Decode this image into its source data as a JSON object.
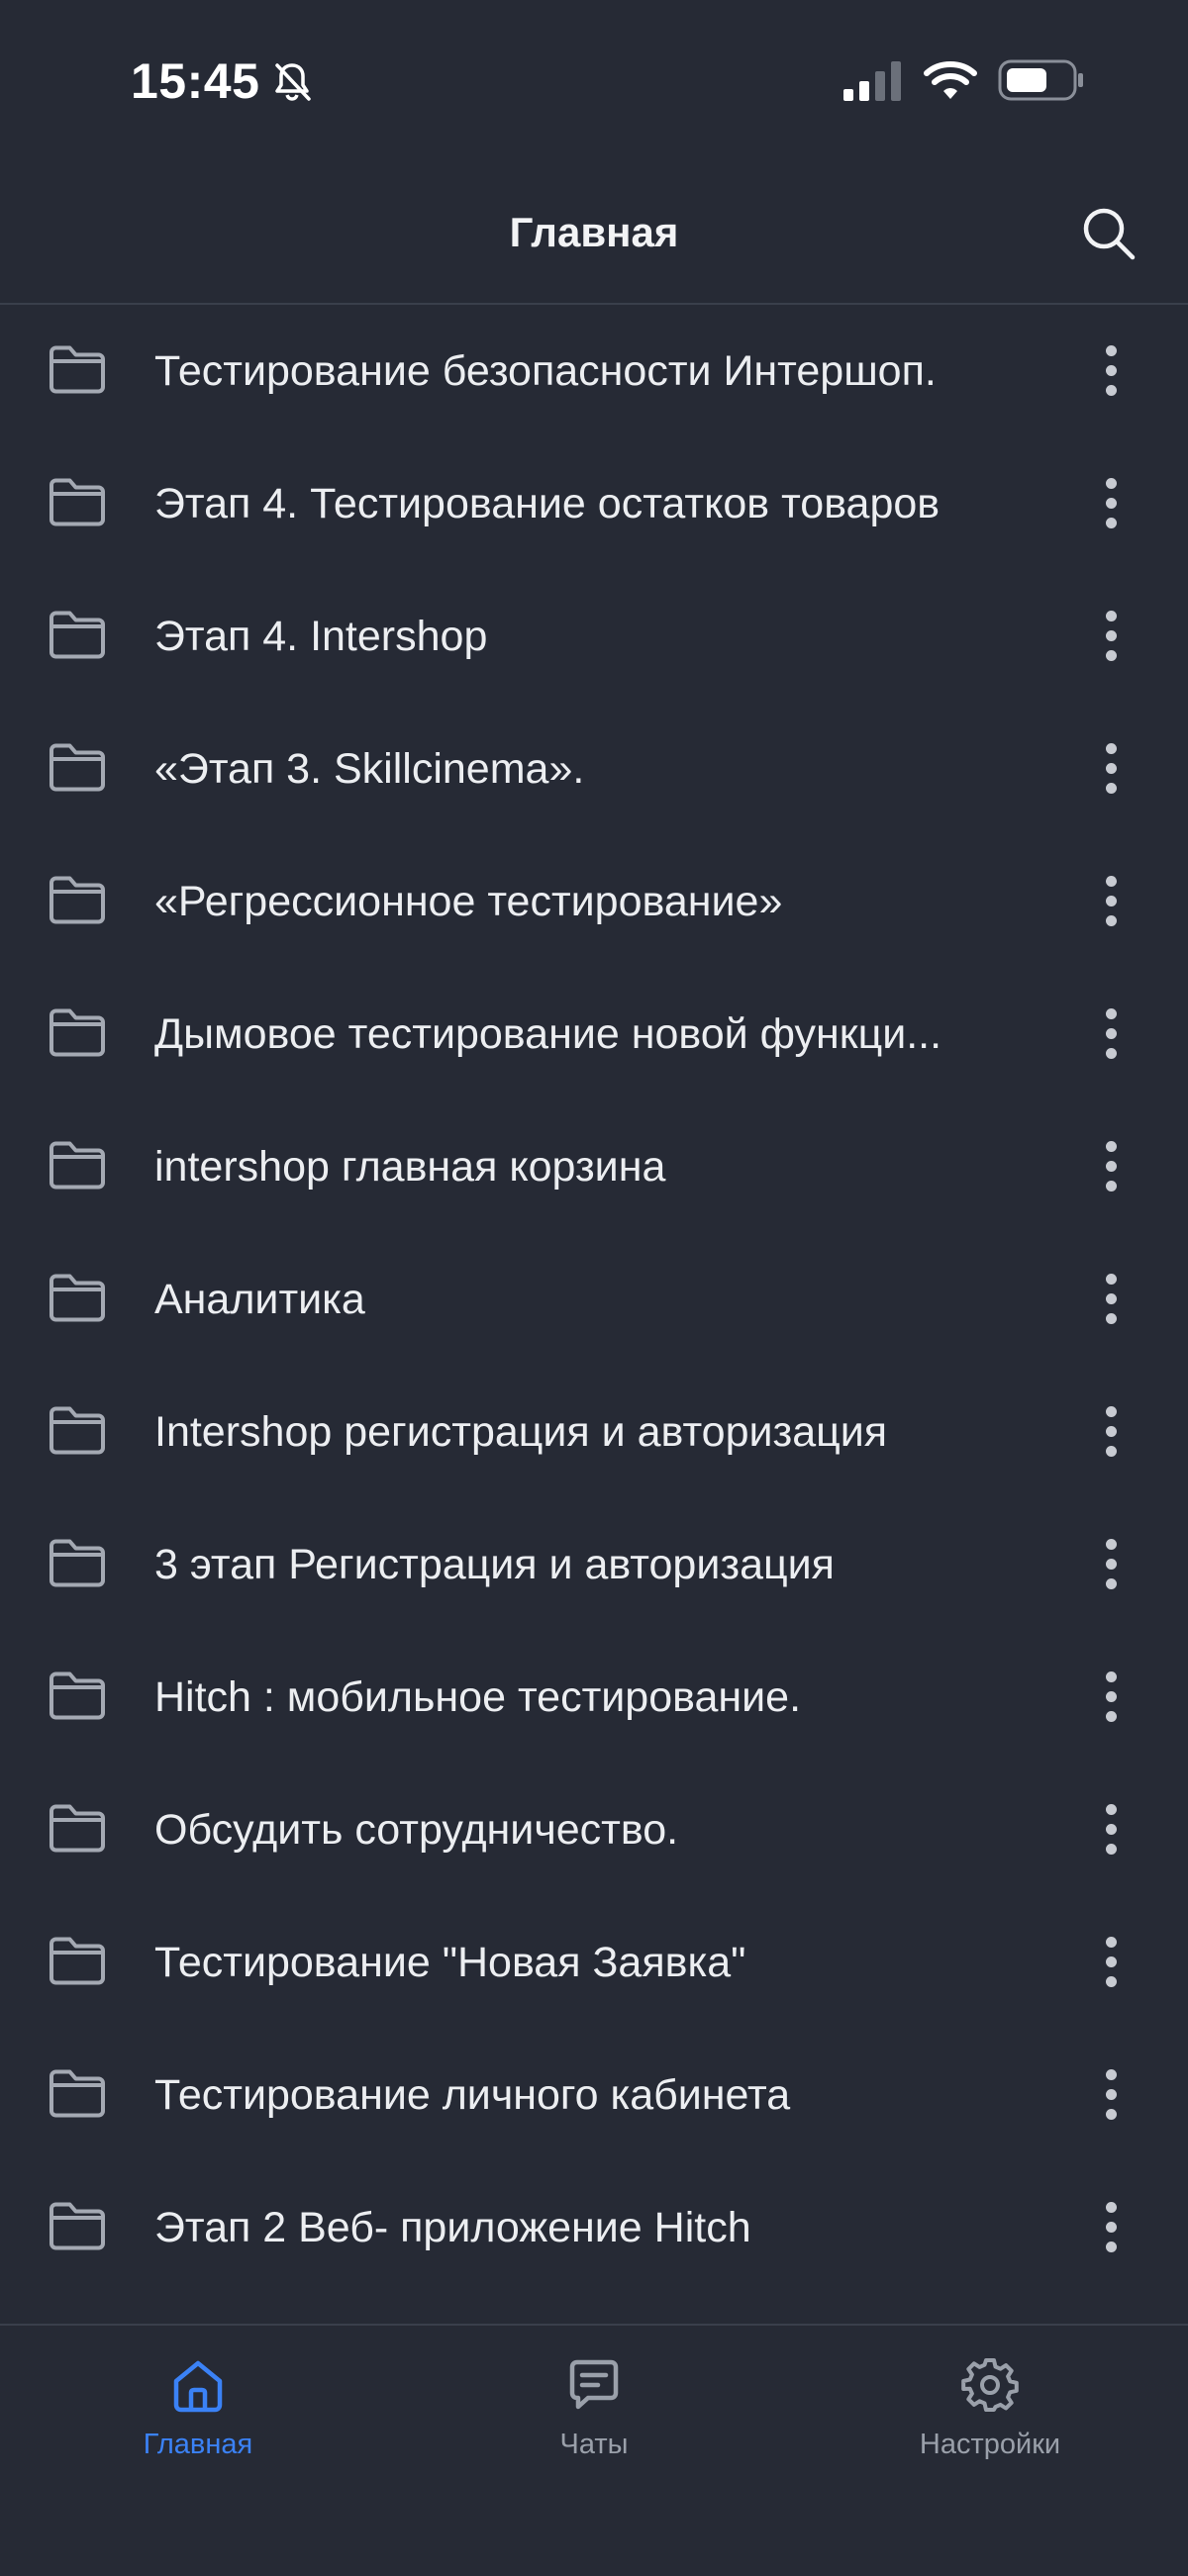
{
  "status_bar": {
    "time": "15:45",
    "icons": [
      "bell-slash-icon",
      "signal-icon",
      "wifi-icon",
      "battery-icon"
    ]
  },
  "header": {
    "title": "Главная",
    "search_icon": "search-icon"
  },
  "folders": [
    {
      "name": "Тестирование безопасности Интершоп."
    },
    {
      "name": "Этап 4. Тестирование остатков товаров"
    },
    {
      "name": "Этап 4. Intershop"
    },
    {
      "name": "«Этап 3. Skillcinema»."
    },
    {
      "name": "«Регрессионное тестирование»"
    },
    {
      "name": "Дымовое тестирование новой функци..."
    },
    {
      "name": "intershop главная корзина"
    },
    {
      "name": "Аналитика"
    },
    {
      "name": "Intershop регистрация и авторизация"
    },
    {
      "name": "3 этап Регистрация и авторизация"
    },
    {
      "name": "Hitch : мобильное тестирование."
    },
    {
      "name": "Обсудить сотрудничество."
    },
    {
      "name": "Тестирование \"Новая Заявка\""
    },
    {
      "name": "Тестирование личного кабинета"
    },
    {
      "name": "Этап 2 Веб- приложение Hitch"
    }
  ],
  "tab_bar": {
    "tabs": [
      {
        "label": "Главная",
        "icon": "home-icon",
        "active": true
      },
      {
        "label": "Чаты",
        "icon": "chat-icon",
        "active": false
      },
      {
        "label": "Настройки",
        "icon": "gear-icon",
        "active": false
      }
    ]
  },
  "colors": {
    "background": "#262a35",
    "accent": "#3b82f6",
    "text": "#eceef1",
    "muted": "#9aa0aa",
    "divider": "#3a3f4b"
  }
}
